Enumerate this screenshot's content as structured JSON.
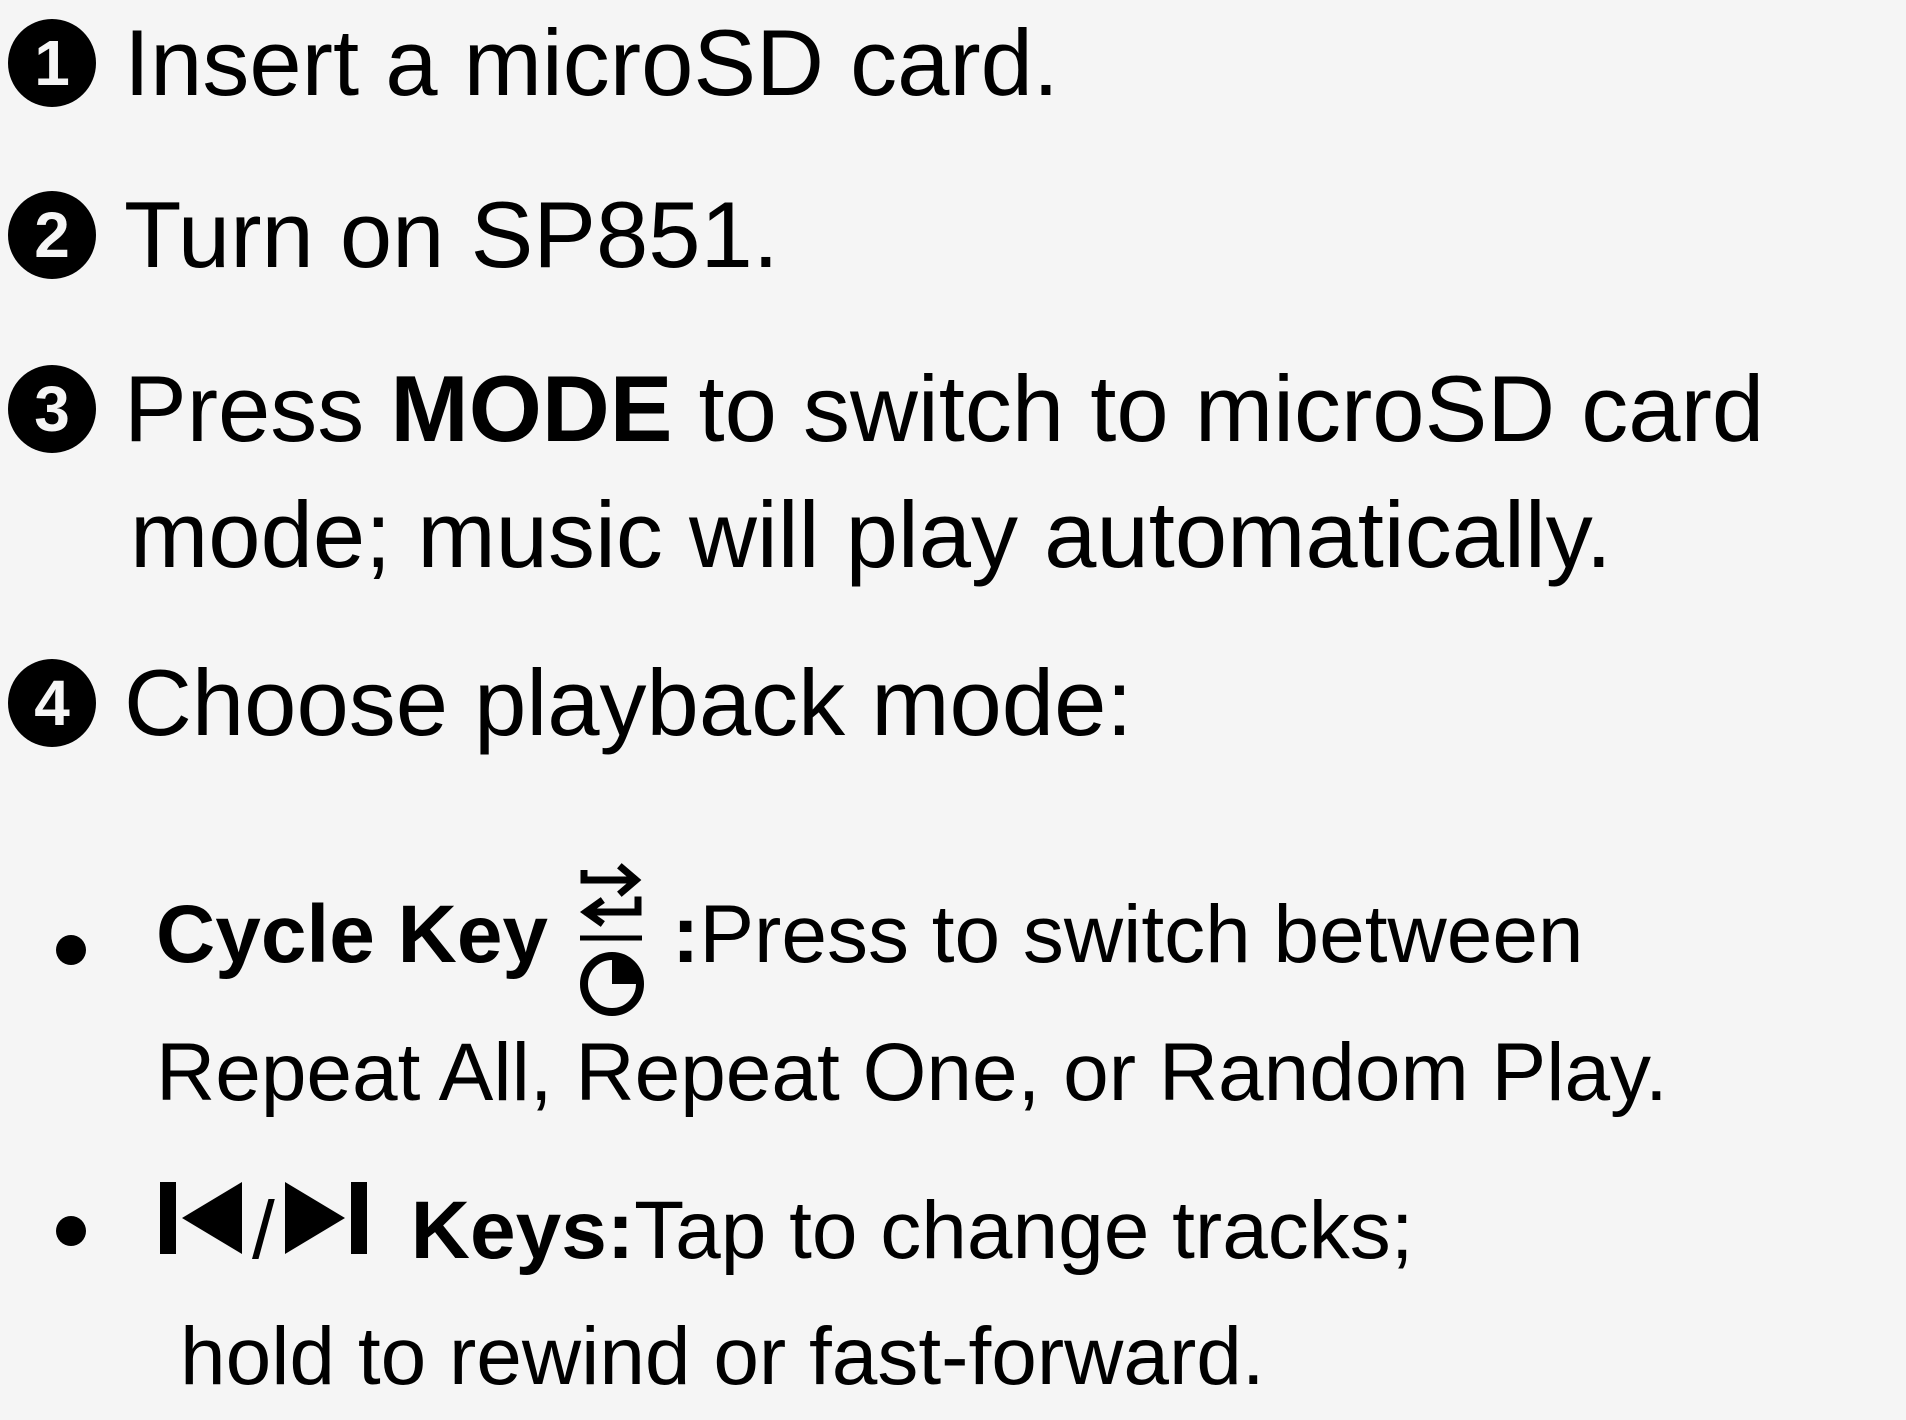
{
  "steps": [
    {
      "number": "1",
      "text": "Insert a microSD card."
    },
    {
      "number": "2",
      "text": "Turn on SP851."
    },
    {
      "number": "3",
      "text_before": "Press ",
      "bold": "MODE",
      "text_after": " to switch to microSD card",
      "continuation": "mode; music will play automatically."
    },
    {
      "number": "4",
      "text": "Choose playback mode:"
    }
  ],
  "bullets": [
    {
      "label": "Cycle Key",
      "icon": "cycle-repeat-clock-icon",
      "separator": ":",
      "text": " Press to switch between",
      "continuation": "Repeat All, Repeat One, or Random Play."
    },
    {
      "icon_prev": "previous-track-icon",
      "slash": " / ",
      "icon_next": "next-track-icon",
      "label": "Keys:",
      "text": " Tap to change tracks;",
      "continuation": "hold to rewind or fast-forward."
    }
  ]
}
